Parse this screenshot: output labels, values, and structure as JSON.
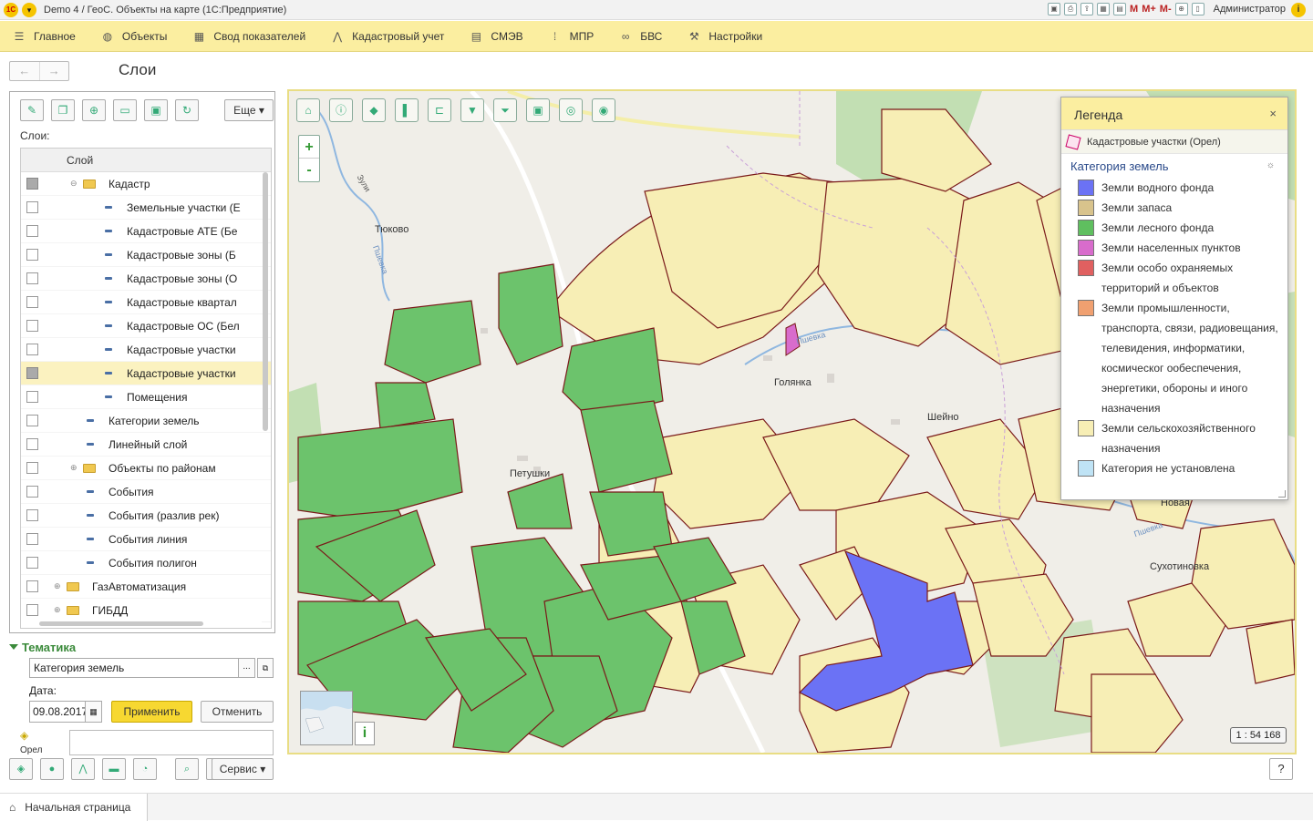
{
  "titlebar": {
    "logo": "1С",
    "title": "Demo 4 / ГеоС. Объекты на карте   (1С:Предприятие)",
    "m_labels": [
      "M",
      "M+",
      "M-"
    ],
    "user": "Администратор",
    "info": "i"
  },
  "menu": [
    {
      "icon": "menu-icon",
      "glyph": "☰",
      "label": "Главное"
    },
    {
      "icon": "globe-icon",
      "glyph": "◍",
      "label": "Объекты"
    },
    {
      "icon": "table-icon",
      "glyph": "▦",
      "label": "Свод показателей"
    },
    {
      "icon": "compass-icon",
      "glyph": "⋀",
      "label": "Кадастровый учет"
    },
    {
      "icon": "document-icon",
      "glyph": "▤",
      "label": "СМЭВ"
    },
    {
      "icon": "grid-icon",
      "glyph": "⁞",
      "label": "МПР"
    },
    {
      "icon": "link-icon",
      "glyph": "∞",
      "label": "БВС"
    },
    {
      "icon": "wrench-icon",
      "glyph": "⚒",
      "label": "Настройки"
    }
  ],
  "nav": {
    "back": "←",
    "forward": "→"
  },
  "page_title": "Слои",
  "layers_panel": {
    "more_button": "Еще",
    "layers_label": "Слои:",
    "column_header": "Слой",
    "rows": [
      {
        "label": "Кадастр",
        "kind": "folder",
        "indent": 1,
        "expander": "⊖",
        "check": "partial"
      },
      {
        "label": "Земельные участки (Е",
        "kind": "layer",
        "indent": 2,
        "check": "off"
      },
      {
        "label": "Кадастровые АТЕ (Бе",
        "kind": "layer",
        "indent": 2,
        "check": "off"
      },
      {
        "label": "Кадастровые зоны (Б",
        "kind": "layer",
        "indent": 2,
        "check": "off"
      },
      {
        "label": "Кадастровые зоны (О",
        "kind": "layer",
        "indent": 2,
        "check": "off"
      },
      {
        "label": "Кадастровые квартал",
        "kind": "layer",
        "indent": 2,
        "check": "off"
      },
      {
        "label": "Кадастровые ОС (Бел",
        "kind": "layer",
        "indent": 2,
        "check": "off"
      },
      {
        "label": "Кадастровые участки",
        "kind": "layer",
        "indent": 2,
        "check": "off"
      },
      {
        "label": "Кадастровые участки",
        "kind": "layer",
        "indent": 2,
        "check": "partial",
        "selected": true
      },
      {
        "label": "Помещения",
        "kind": "layer",
        "indent": 2,
        "check": "off"
      },
      {
        "label": "Категории земель",
        "kind": "layer",
        "indent": 1,
        "check": "off"
      },
      {
        "label": "Линейный слой",
        "kind": "layer",
        "indent": 1,
        "check": "off"
      },
      {
        "label": "Объекты по районам",
        "kind": "folder",
        "indent": 1,
        "expander": "⊕",
        "check": "off"
      },
      {
        "label": "События",
        "kind": "layer",
        "indent": 1,
        "check": "off"
      },
      {
        "label": "События (разлив рек)",
        "kind": "layer",
        "indent": 1,
        "check": "off"
      },
      {
        "label": "События линия",
        "kind": "layer",
        "indent": 1,
        "check": "off"
      },
      {
        "label": "События полигон",
        "kind": "layer",
        "indent": 1,
        "check": "off"
      },
      {
        "label": "ГазАвтоматизация",
        "kind": "folder",
        "indent": 0,
        "expander": "⊕",
        "check": "off"
      },
      {
        "label": "ГИБДД",
        "kind": "folder",
        "indent": 0,
        "expander": "⊕",
        "check": "off"
      }
    ]
  },
  "thematic": {
    "title": "Тематика",
    "value": "Категория земель",
    "date_label": "Дата:",
    "date_value": "09.08.2017",
    "apply": "Применить",
    "cancel": "Отменить",
    "tile_label": "Орел"
  },
  "legend": {
    "title": "Легенда",
    "close": "×",
    "layer": "Кадастровые участки (Орел)",
    "category_title": "Категория земель",
    "items": [
      {
        "label": "Земли водного фонда",
        "color": "#6b72f5"
      },
      {
        "label": "Земли запаса",
        "color": "#d8c38c"
      },
      {
        "label": "Земли лесного фонда",
        "color": "#5fbf5f"
      },
      {
        "label": "Земли населенных пунктов",
        "color": "#d86ccc"
      },
      {
        "label": "Земли особо охраняемых территорий и объектов",
        "color": "#e06060"
      },
      {
        "label": "Земли промышленности, транспорта, связи, радиовещания, телевидения, информатики, космическог ообеспечения, энергетики, обороны и иного назначения",
        "color": "#f0a070"
      },
      {
        "label": "Земли сельскохозяйственного назначения",
        "color": "#f7eeb5"
      },
      {
        "label": "Категория не установлена",
        "color": "#bfe3f5"
      }
    ]
  },
  "map": {
    "places": [
      {
        "name": "Тюково"
      },
      {
        "name": "Голянка"
      },
      {
        "name": "Шейно"
      },
      {
        "name": "Петушки"
      },
      {
        "name": "Новая"
      },
      {
        "name": "Сухотиновка"
      }
    ],
    "rivers": [
      "Пшевка",
      "Пшевка",
      "Пшевка"
    ],
    "roads": [
      "Зули"
    ],
    "scale": "1 : 54 168",
    "zoom_in": "+",
    "zoom_out": "-",
    "info_btn": "i",
    "colors": {
      "forest": "#6cc36c",
      "agri": "#f7eeb5",
      "water": "#6b72f5",
      "settlement": "#d86ccc",
      "boundary": "#7a1a1a"
    }
  },
  "bottom": {
    "servis": "Сервис",
    "help": "?"
  },
  "tabs": {
    "home": "Начальная страница"
  }
}
